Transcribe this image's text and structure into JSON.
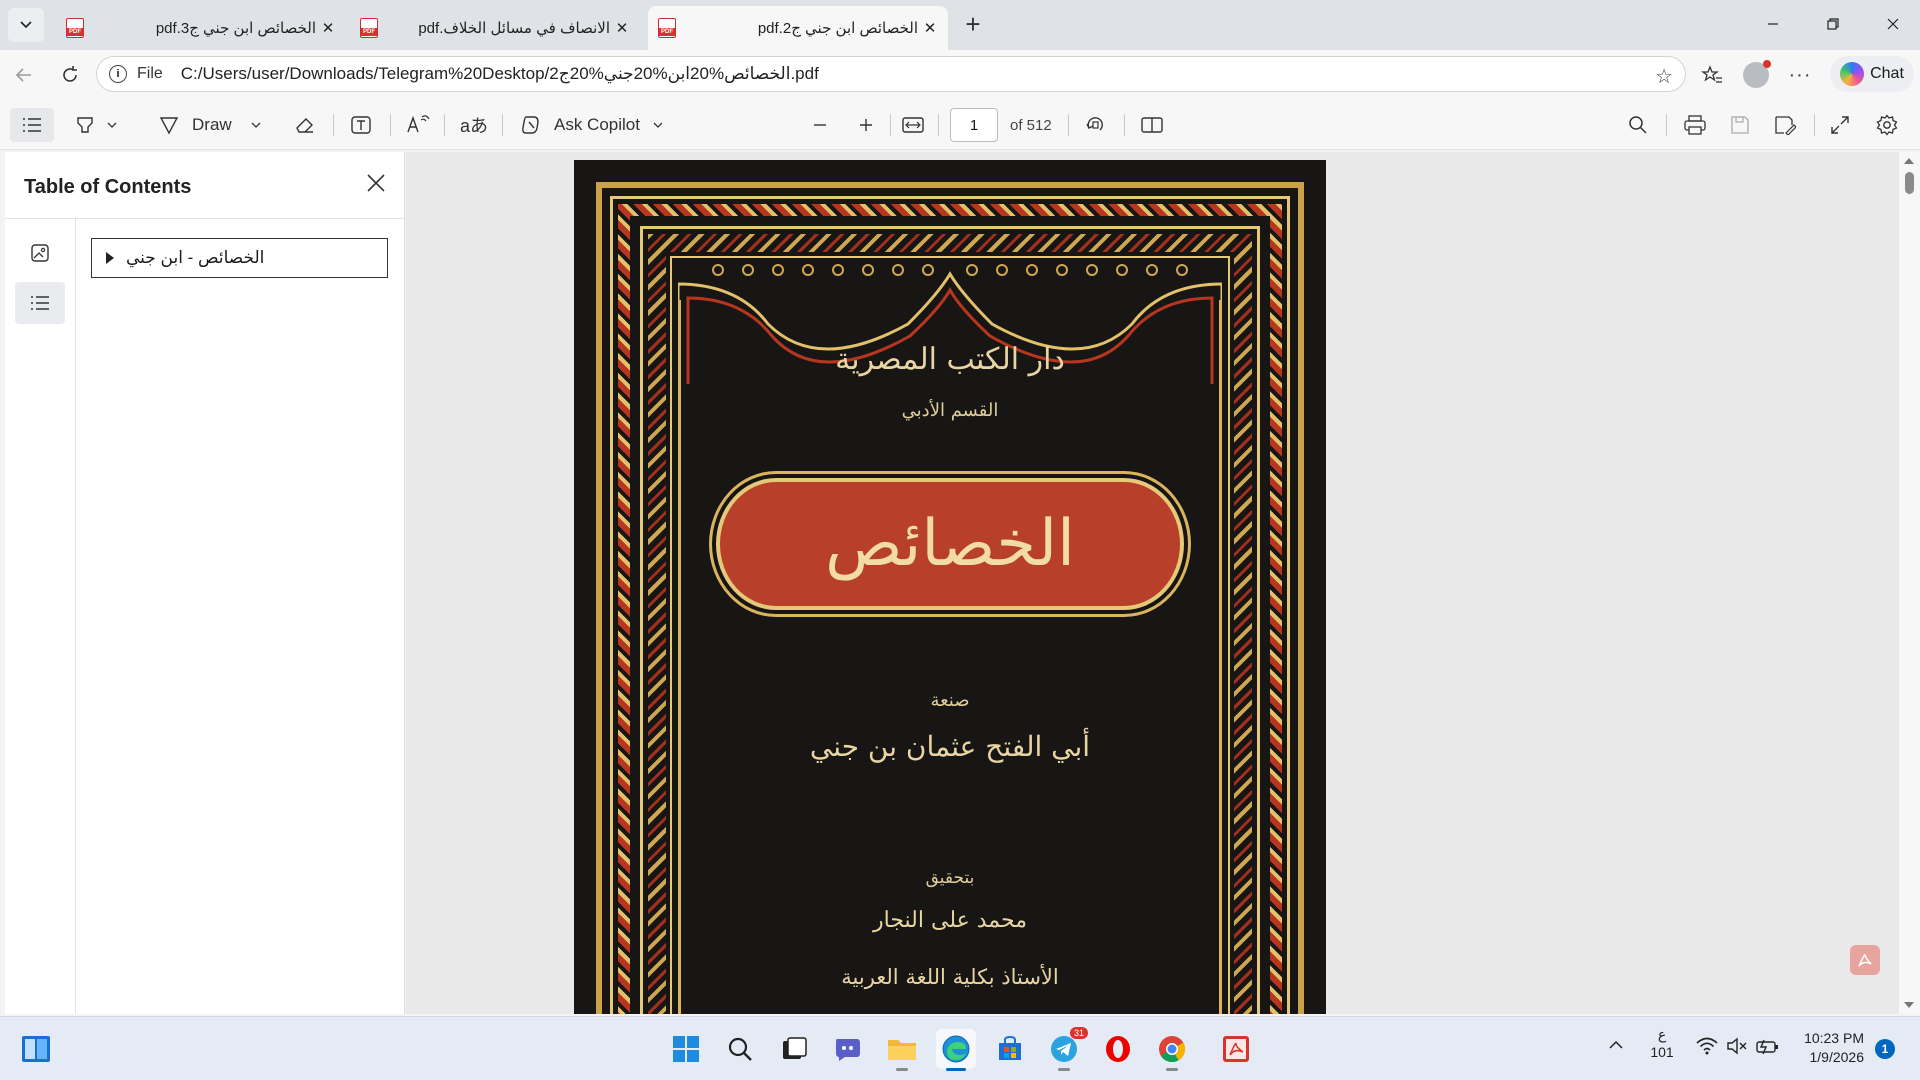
{
  "tabs": [
    {
      "title": "الخصائص ابن جني ج3.pdf",
      "active": false
    },
    {
      "title": "الانصاف في مسائل الخلاف.pdf",
      "active": false
    },
    {
      "title": "الخصائص ابن جني ج2.pdf",
      "active": true
    }
  ],
  "address": {
    "scheme_label": "File",
    "url": "C:/Users/user/Downloads/Telegram%20Desktop/الخصائص%20ابن%20جني%20ج2.pdf"
  },
  "chat_label": "Chat",
  "toolbar": {
    "draw_label": "Draw",
    "copilot_label": "Ask Copilot",
    "page_current": "1",
    "page_total_label": "of 512"
  },
  "sidebar": {
    "title": "Table of Contents",
    "toc": [
      {
        "label": "الخصائص - ابن جني"
      }
    ]
  },
  "cover": {
    "publisher": "دار الكتب المصرية",
    "division": "القسم الأدبي",
    "title": "الخصائص",
    "by_label": "صنعة",
    "author": "أبي الفتح عثمان بن جني",
    "editor_label": "بتحقيق",
    "editor": "محمد على النجار",
    "editor_title": "الأستاذ بكلية اللغة العربية"
  },
  "taskbar": {
    "apps": [
      {
        "name": "windows-start"
      },
      {
        "name": "search"
      },
      {
        "name": "task-view"
      },
      {
        "name": "chat-meet"
      },
      {
        "name": "file-explorer"
      },
      {
        "name": "edge",
        "active": true
      },
      {
        "name": "store"
      },
      {
        "name": "telegram",
        "badge": "31"
      },
      {
        "name": "opera"
      },
      {
        "name": "chrome"
      },
      {
        "name": "acrobat"
      }
    ],
    "lang_top": "ع",
    "lang_bottom": "101",
    "time": "10:23 PM",
    "date": "1/9/2026",
    "notification_count": "1"
  }
}
